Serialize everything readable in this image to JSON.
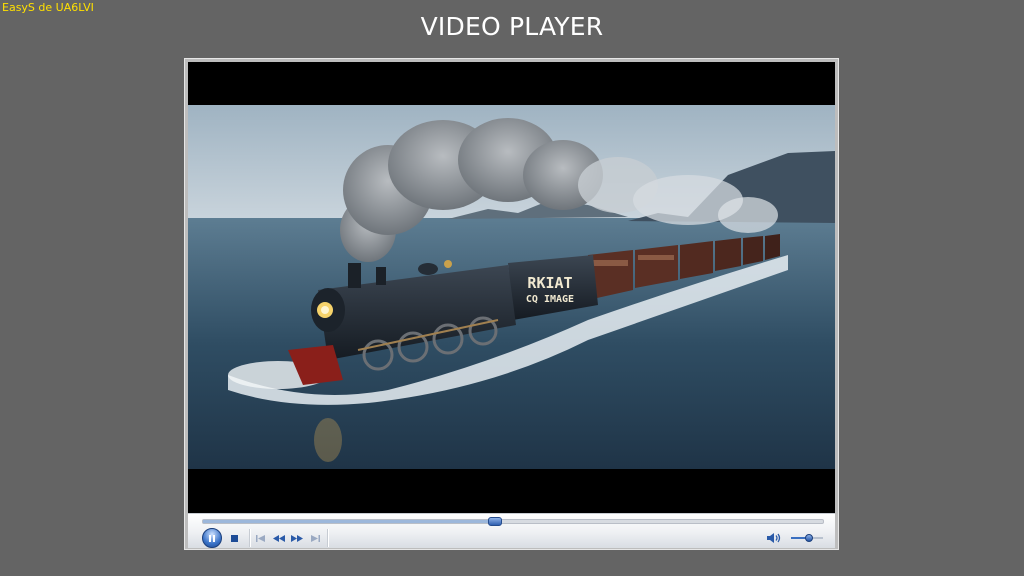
{
  "app": {
    "title": "EasyS de UA6LVI"
  },
  "page": {
    "title": "VIDEO PLAYER"
  },
  "player": {
    "video": {
      "description": "steam locomotive crossing the sea",
      "tender_text_line1": "RKIAT",
      "tender_text_line2": "CQ IMAGE"
    },
    "seek": {
      "progress": 0.47
    },
    "volume": {
      "level": 0.55
    },
    "icons": {
      "play_pause": "pause-icon",
      "stop": "stop-icon",
      "previous": "skip-previous-icon",
      "rewind": "rewind-icon",
      "fast_forward": "fast-forward-icon",
      "next": "skip-next-icon",
      "volume": "speaker-icon"
    },
    "colors": {
      "accent": "#2f5fb0",
      "background": "#646464",
      "app_title": "#ffe000"
    }
  }
}
